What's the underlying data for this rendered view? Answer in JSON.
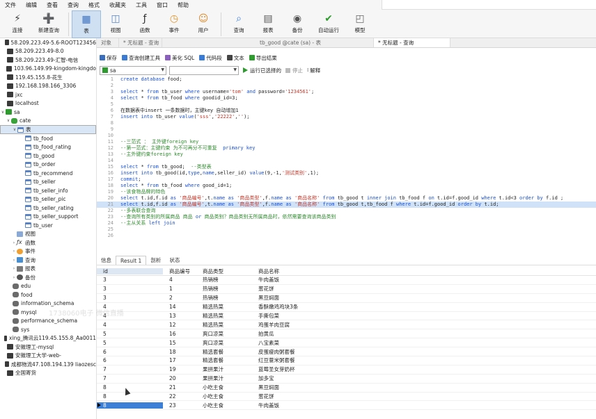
{
  "menu": [
    "文件",
    "编辑",
    "查看",
    "查询",
    "格式",
    "收藏夹",
    "工具",
    "窗口",
    "帮助"
  ],
  "toolbar": [
    {
      "label": "连接",
      "icon": "connect-icon"
    },
    {
      "label": "新建查询",
      "icon": "new-query-icon"
    },
    {
      "label": "表",
      "icon": "table-icon"
    },
    {
      "label": "视图",
      "icon": "view-icon"
    },
    {
      "label": "函数",
      "icon": "function-icon"
    },
    {
      "label": "事件",
      "icon": "event-icon"
    },
    {
      "label": "用户",
      "icon": "user-icon"
    },
    {
      "label": "查询",
      "icon": "query-icon"
    },
    {
      "label": "报表",
      "icon": "report-icon"
    },
    {
      "label": "备份",
      "icon": "backup-icon"
    },
    {
      "label": "自动运行",
      "icon": "autorun-icon"
    },
    {
      "label": "模型",
      "icon": "model-icon"
    }
  ],
  "sidebar": {
    "connections": [
      "58.209.223.49-5.6-ROOT123456",
      "58.209.223.49-8.0",
      "58.209.223.49-汇智-电信",
      "103.96.149.99-kingdom-kingdo",
      "119.45.155.8-花生",
      "192.168.198.166_3306",
      "jxc",
      "localhost"
    ],
    "sa": "sa",
    "cate": "cate",
    "tables_group": "表",
    "tables": [
      "tb_food",
      "tb_food_rating",
      "tb_good",
      "tb_order",
      "tb_recommend",
      "tb_seller",
      "tb_seller_info",
      "tb_seller_pic",
      "tb_seller_rating",
      "tb_seller_support",
      "tb_user"
    ],
    "groups": [
      "视图",
      "函数",
      "事件",
      "查询",
      "报表",
      "备份"
    ],
    "databases": [
      "edu",
      "food",
      "information_schema",
      "mysql",
      "performance_schema",
      "sys"
    ],
    "more_connections": [
      "xing_腾讯云119.45.155.8_Aa0011",
      "安徽理工-mysql",
      "安徽理工大学-web-",
      "成都物流47.108.194.139 liaozesc",
      "全国寄货"
    ]
  },
  "tabs": [
    "对象",
    "* 无标题 - 查询",
    "tb_good @cate (sa) - 表",
    "* 无标题 - 查询"
  ],
  "query_toolbar": [
    "保存",
    "查询创建工具",
    "美化 SQL",
    "代码段",
    "文本",
    "导出结果"
  ],
  "selects": {
    "connection": "sa",
    "database": ""
  },
  "run": {
    "run_label": "运行已选择的",
    "stop_label": "停止",
    "explain_label": "解释"
  },
  "editor": [
    {
      "n": "1",
      "html": "<span class='kw'>create database</span> food;",
      "hl": false
    },
    {
      "n": "2",
      "html": "",
      "hl": false
    },
    {
      "n": "3",
      "html": "<span class='kw'>select</span> * <span class='kw'>from</span> tb_user <span class='kw'>where</span> username=<span class='str'>'tom'</span> <span class='kw'>and</span> password=<span class='str'>'1234561'</span>;",
      "hl": false
    },
    {
      "n": "4",
      "html": "<span class='kw'>select</span> * <span class='kw'>from</span> tb_food <span class='kw'>where</span> goodid_id=3;",
      "hl": false
    },
    {
      "n": "5",
      "html": "",
      "hl": false
    },
    {
      "n": "6",
      "html": "在数据表中insert 一条数据时，主键key 自动增加1",
      "hl": false
    },
    {
      "n": "7",
      "html": "<span class='kw'>insert into</span> tb_user <span class='kw'>value</span>(<span class='str'>'sss'</span>,<span class='str'>'22222'</span>,<span class='str'>''</span>);",
      "hl": false
    },
    {
      "n": "8",
      "html": "",
      "hl": false
    },
    {
      "n": "9",
      "html": "",
      "hl": false
    },
    {
      "n": "10",
      "html": "",
      "hl": false
    },
    {
      "n": "11",
      "html": "<span class='cmt'>--三范式 ： 主外键foreign key</span>",
      "hl": false
    },
    {
      "n": "12",
      "html": "<span class='cmt'>--第一范式：主键约束 为不可再分不可重复  </span><span class='kw'>primary key</span>",
      "hl": false
    },
    {
      "n": "13",
      "html": "<span class='cmt'>--主外键约束foreign key</span>",
      "hl": false
    },
    {
      "n": "14",
      "html": "",
      "hl": false
    },
    {
      "n": "15",
      "html": "<span class='kw'>select</span> * <span class='kw'>from</span> tb_good;  <span class='cmt'>--类型表</span>",
      "hl": false
    },
    {
      "n": "16",
      "html": "<span class='kw'>insert into</span> tb_good(id,<span class='kw'>type</span>,<span class='kw'>name</span>,seller_id) <span class='kw'>value</span>(9,-1,<span class='str'>'测试类别'</span>,1);",
      "hl": false
    },
    {
      "n": "17",
      "html": "<span class='kw'>commit</span>;",
      "hl": false
    },
    {
      "n": "18",
      "html": "<span class='kw'>select</span> * <span class='kw'>from</span> tb_food <span class='kw'>where</span> good_id=1;",
      "hl": false
    },
    {
      "n": "19",
      "html": "<span class='cmt'>--该食物品牌的特色</span>",
      "hl": false
    },
    {
      "n": "20",
      "html": "<span class='kw'>select</span> t.id,f.id <span class='kw'>as</span> <span class='str'>'商品编号'</span>,t.<span class='kw'>name</span> <span class='kw'>as</span> <span class='str'>'商品类型'</span>,f.<span class='kw'>name</span> <span class='kw'>as</span> <span class='str'>'商品名称'</span> <span class='kw'>from</span> tb_good t <span class='kw'>inner join</span> tb_food f <span class='kw'>on</span> t.id=f.good_id <span class='kw'>where</span> t.id&lt;3 <span class='kw'>order by</span> f.id ;",
      "hl": false
    },
    {
      "n": "21",
      "html": "<span class='kw'>select</span> t.id,f.id <span class='kw'>as</span> <span class='str'>'商品编号'</span>,t.<span class='kw'>name</span> <span class='kw'>as</span> <span class='str'>'商品类型'</span>,f.<span class='kw'>name</span> <span class='kw'>as</span> <span class='str'>'商品名称'</span> <span class='kw'>from</span> tb_good t,tb_food f <span class='kw'>where</span> t.id=f.good_id <span class='kw'>order by</span> t.id;",
      "hl": true
    },
    {
      "n": "22",
      "html": "<span class='cmt'>--多表联合查询</span>",
      "hl": false
    },
    {
      "n": "23",
      "html": "<span class='cmt'>--查询所有类别的所属商品 商品 </span><span class='kw'>or</span><span class='cmt'> 商品类别？商品类别无所属商品时，依然需要查询该商品类别</span>",
      "hl": false
    },
    {
      "n": "24",
      "html": "<span class='cmt'>--主从关系 </span><span class='kw'>left join</span>",
      "hl": false
    },
    {
      "n": "25",
      "html": "",
      "hl": false
    },
    {
      "n": "26",
      "html": "",
      "hl": false
    }
  ],
  "result_tabs": [
    "信息",
    "Result 1",
    "剖析",
    "状态"
  ],
  "grid": {
    "columns": [
      "id",
      "商品编号",
      "商品类型",
      "商品名称"
    ],
    "rows": [
      [
        "3",
        "4",
        "热销榜",
        "牛肉盖饭"
      ],
      [
        "3",
        "1",
        "热销榜",
        "葱花饼"
      ],
      [
        "3",
        "2",
        "热销榜",
        "黑豆焖面"
      ],
      [
        "4",
        "14",
        "精选热菜",
        "香酥嫩鸡鸡块3条"
      ],
      [
        "4",
        "13",
        "精选热菜",
        "手撕包菜"
      ],
      [
        "4",
        "12",
        "精选热菜",
        "鸡蛋羊肉豆腐"
      ],
      [
        "5",
        "16",
        "爽口凉菜",
        "拍黄瓜"
      ],
      [
        "5",
        "15",
        "爽口凉菜",
        "八宝素菜"
      ],
      [
        "6",
        "18",
        "精选套餐",
        "皮蛋瘦肉粥套餐"
      ],
      [
        "6",
        "17",
        "精选套餐",
        "红豆薏米粥套餐"
      ],
      [
        "7",
        "19",
        "果拼果汁",
        "蓝莓圣女芽奶杯"
      ],
      [
        "7",
        "20",
        "果拼果汁",
        "加多宝"
      ],
      [
        "8",
        "21",
        "小吃主食",
        "黑豆焖面"
      ],
      [
        "8",
        "22",
        "小吃主食",
        "葱花饼"
      ],
      [
        "8",
        "23",
        "小吃主食",
        "牛肉盖饭"
      ]
    ]
  },
  "watermark": "1738060电子 微信直播"
}
